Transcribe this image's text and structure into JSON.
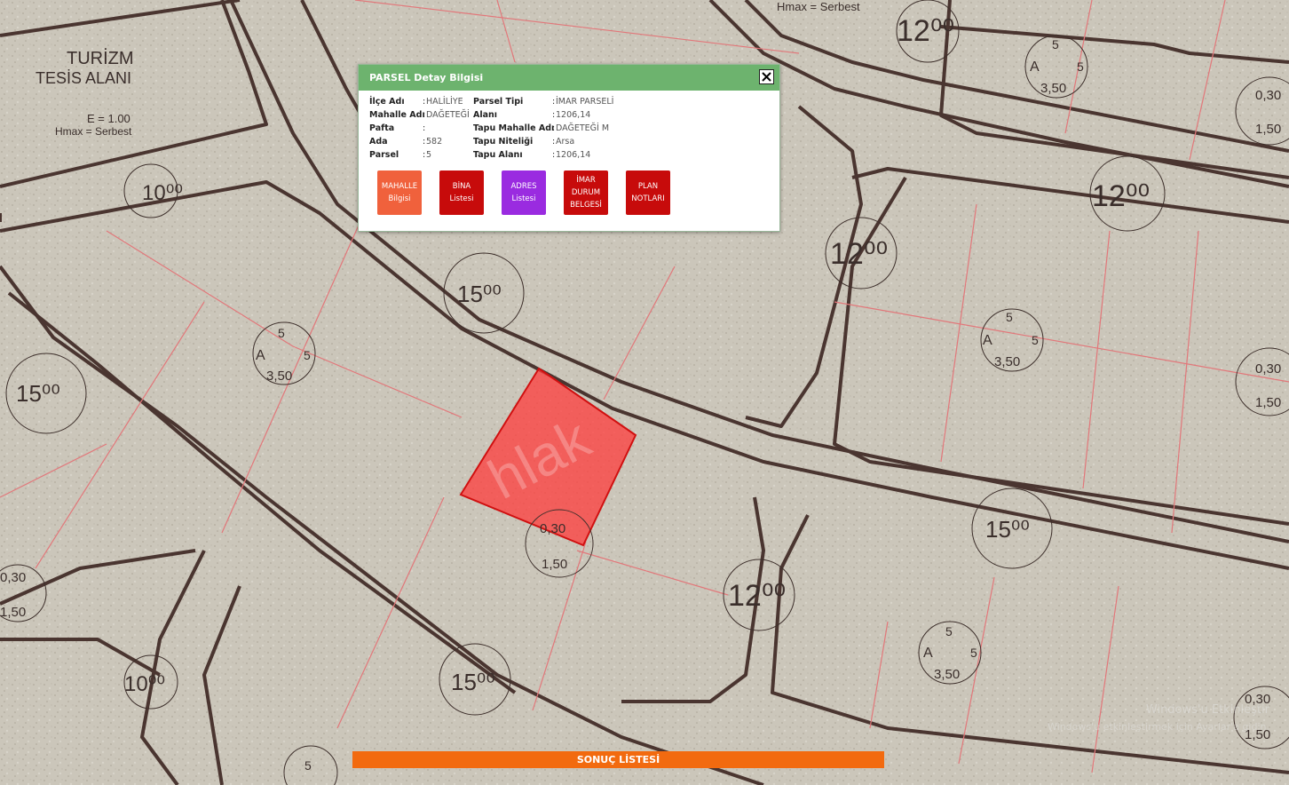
{
  "popup": {
    "title": "PARSEL Detay Bilgisi",
    "fields_left": [
      {
        "label": "İlçe Adı",
        "value": "HALİLİYE"
      },
      {
        "label": "Mahalle Adı",
        "value": "DAĞETEĞİ"
      },
      {
        "label": "Pafta",
        "value": ""
      },
      {
        "label": "Ada",
        "value": "582"
      },
      {
        "label": "Parsel",
        "value": "5"
      }
    ],
    "fields_right": [
      {
        "label": "Parsel Tipi",
        "value": "İMAR PARSELİ"
      },
      {
        "label": "Alanı",
        "value": "1206,14"
      },
      {
        "label": "Tapu Mahalle Adı",
        "value": "DAĞETEĞİ M"
      },
      {
        "label": "Tapu Niteliği",
        "value": "Arsa"
      },
      {
        "label": "Tapu Alanı",
        "value": "1206,14"
      }
    ],
    "separator": ":",
    "buttons": [
      {
        "lines": [
          "MAHALLE",
          "Bilgisi"
        ],
        "color": "#f0613c"
      },
      {
        "lines": [
          "BİNA",
          "Listesi"
        ],
        "color": "#c70b0b"
      },
      {
        "lines": [
          "ADRES",
          "Listesi"
        ],
        "color": "#9a2be0"
      },
      {
        "lines": [
          "İMAR",
          "DURUM",
          "BELGESİ"
        ],
        "color": "#c70b0b"
      },
      {
        "lines": [
          "PLAN",
          "NOTLARI"
        ],
        "color": "#c70b0b"
      }
    ]
  },
  "map": {
    "labels": {
      "tourism": [
        "TURİZM",
        "TESİS ALANI"
      ],
      "zoning_top": "Hmax = Serbest",
      "zoning_left": "E = 1.00",
      "zoning_left2": "Hmax = Serbest",
      "road_widths": [
        "10⁰⁰",
        "12⁰⁰",
        "15⁰⁰"
      ],
      "density_a": [
        "5",
        "A",
        "5",
        "3,50"
      ],
      "density_b": [
        "0,30",
        "1,50"
      ]
    },
    "selected_parcel_color": "#ff3b3b",
    "watermark_center": "hlak",
    "watermark": [
      "Windows'u Etkinleştir",
      "Windows'u etkinleştirmek için Ayarlar'a gidin."
    ]
  },
  "result_bar": {
    "label": "SONUÇ LİSTESİ"
  }
}
